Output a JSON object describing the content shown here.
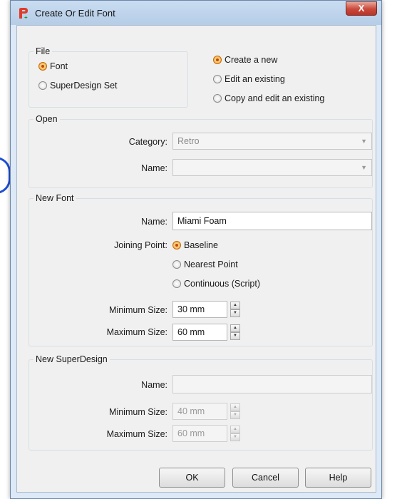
{
  "window": {
    "title": "Create Or Edit Font",
    "close_glyph": "X",
    "app_icon": "font-editor-icon"
  },
  "file_group": {
    "legend": "File",
    "font_label": "Font",
    "superdesign_label": "SuperDesign Set",
    "selected": "Font"
  },
  "mode_group": {
    "create_new": "Create a new",
    "edit_existing": "Edit an existing",
    "copy_edit": "Copy and edit an existing",
    "selected": "Create a new"
  },
  "open_group": {
    "legend": "Open",
    "category_label": "Category:",
    "category_value": "Retro",
    "name_label": "Name:",
    "name_value": ""
  },
  "new_font_group": {
    "legend": "New Font",
    "name_label": "Name:",
    "name_value": "Miami Foam",
    "joining_label": "Joining Point:",
    "joining_options": [
      "Baseline",
      "Nearest Point",
      "Continuous (Script)"
    ],
    "joining_selected": "Baseline",
    "min_label": "Minimum Size:",
    "min_value": "30 mm",
    "max_label": "Maximum Size:",
    "max_value": "60 mm"
  },
  "new_superdesign_group": {
    "legend": "New SuperDesign",
    "name_label": "Name:",
    "name_value": "",
    "min_label": "Minimum Size:",
    "min_value": "40 mm",
    "max_label": "Maximum Size:",
    "max_value": "60 mm"
  },
  "buttons": {
    "ok": "OK",
    "cancel": "Cancel",
    "help": "Help"
  },
  "colors": {
    "accent_radio": "#f3a33a",
    "title_bar": "#c9dcf1",
    "close_button": "#c9483a"
  }
}
